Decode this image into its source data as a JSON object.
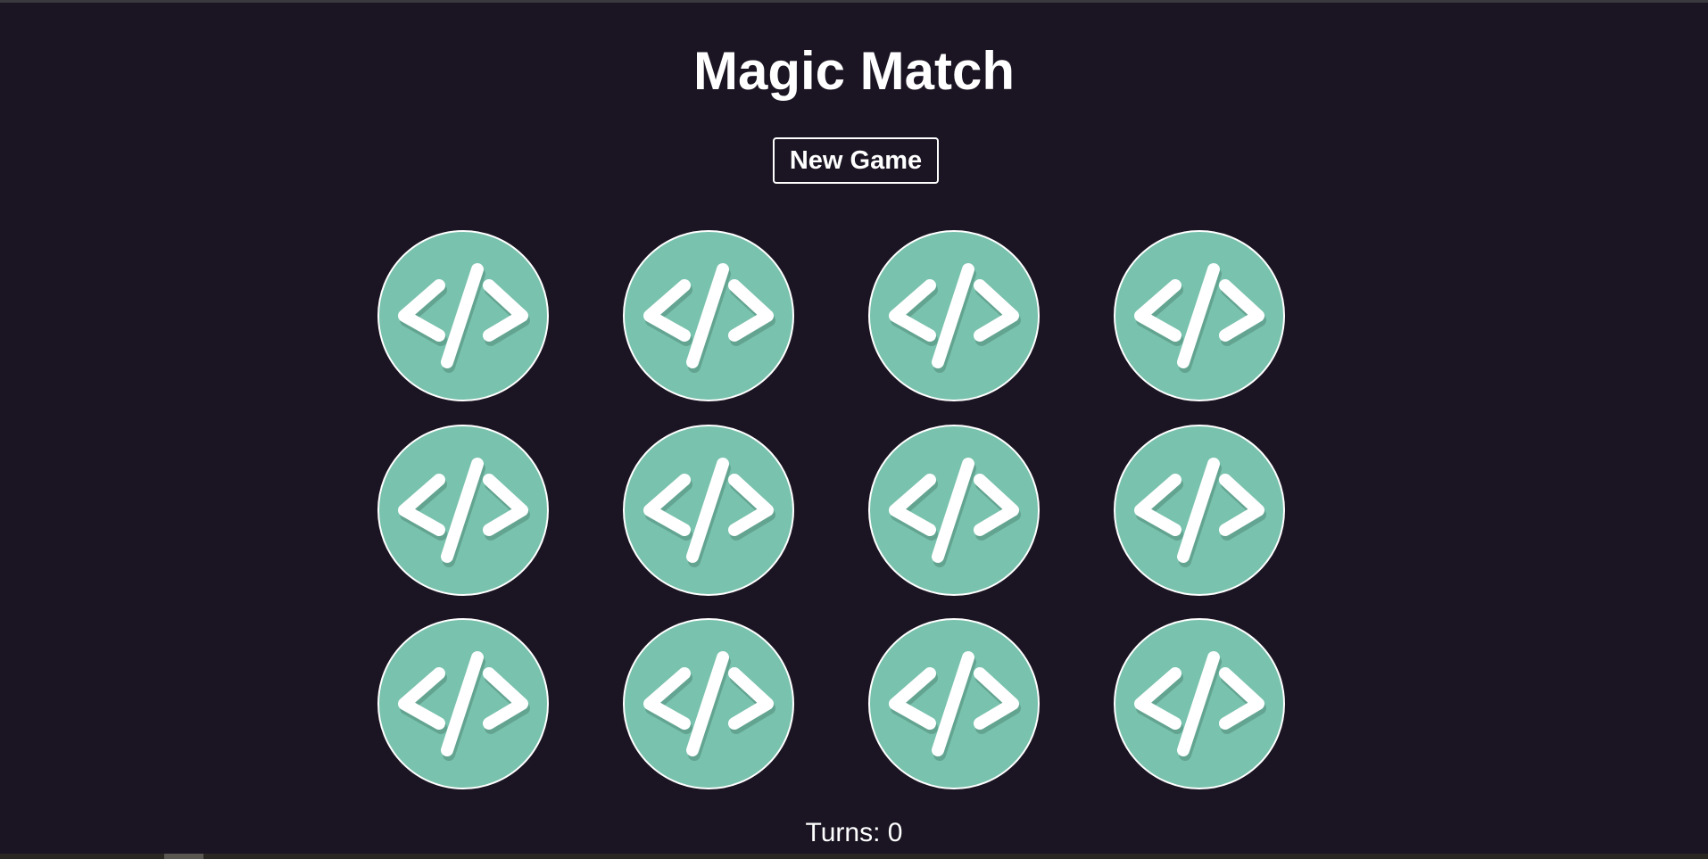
{
  "game": {
    "title": "Magic Match",
    "new_game_label": "New Game",
    "turns_label": "Turns: 0",
    "card_back_icon": "code-icon",
    "colors": {
      "background": "#1b1523",
      "card_back": "#79c2ad",
      "text": "#ffffff"
    },
    "cards": [
      {
        "face": "hidden"
      },
      {
        "face": "hidden"
      },
      {
        "face": "hidden"
      },
      {
        "face": "hidden"
      },
      {
        "face": "hidden"
      },
      {
        "face": "hidden"
      },
      {
        "face": "hidden"
      },
      {
        "face": "hidden"
      },
      {
        "face": "hidden"
      },
      {
        "face": "hidden"
      },
      {
        "face": "hidden"
      },
      {
        "face": "hidden"
      }
    ]
  }
}
